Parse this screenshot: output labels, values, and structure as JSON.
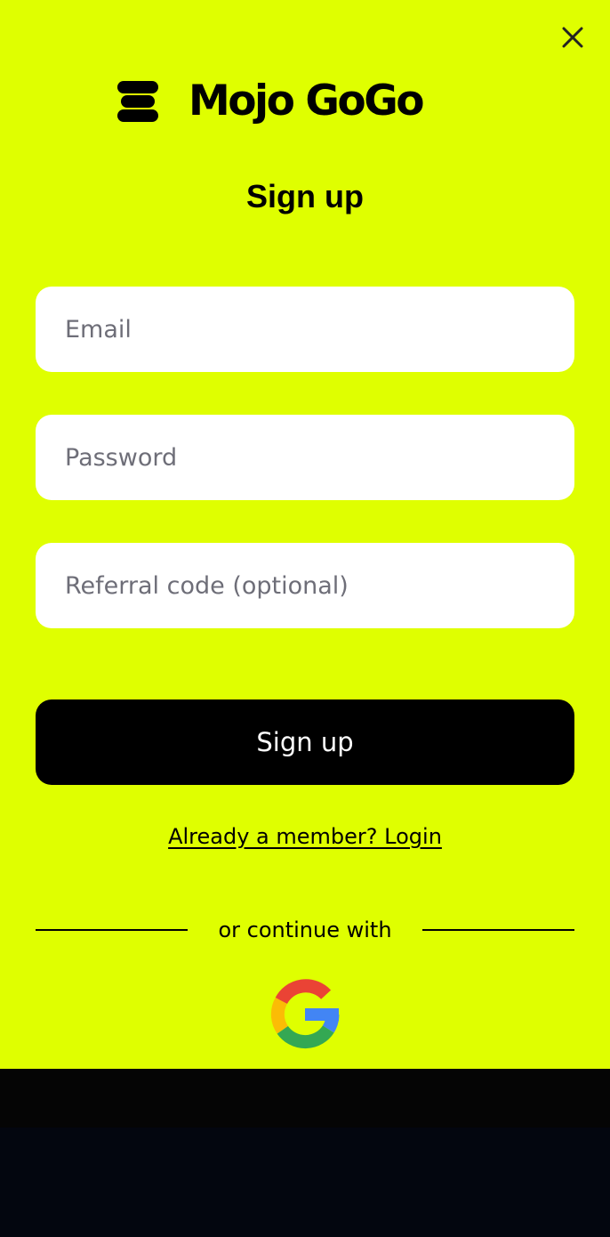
{
  "brand": {
    "name": "Mojo GoGo"
  },
  "form": {
    "title": "Sign up",
    "email_placeholder": "Email",
    "password_placeholder": "Password",
    "referral_placeholder": "Referral code (optional)",
    "submit_label": "Sign up",
    "login_link": "Already a member? Login"
  },
  "social": {
    "divider_text": "or continue with",
    "providers": [
      "google-icon"
    ]
  },
  "icons": {
    "close": "close-icon",
    "logo": "mojo-logo-icon"
  },
  "colors": {
    "background": "#dfff00",
    "button": "#000000",
    "field": "#ffffff",
    "bottom": "#03060f"
  }
}
